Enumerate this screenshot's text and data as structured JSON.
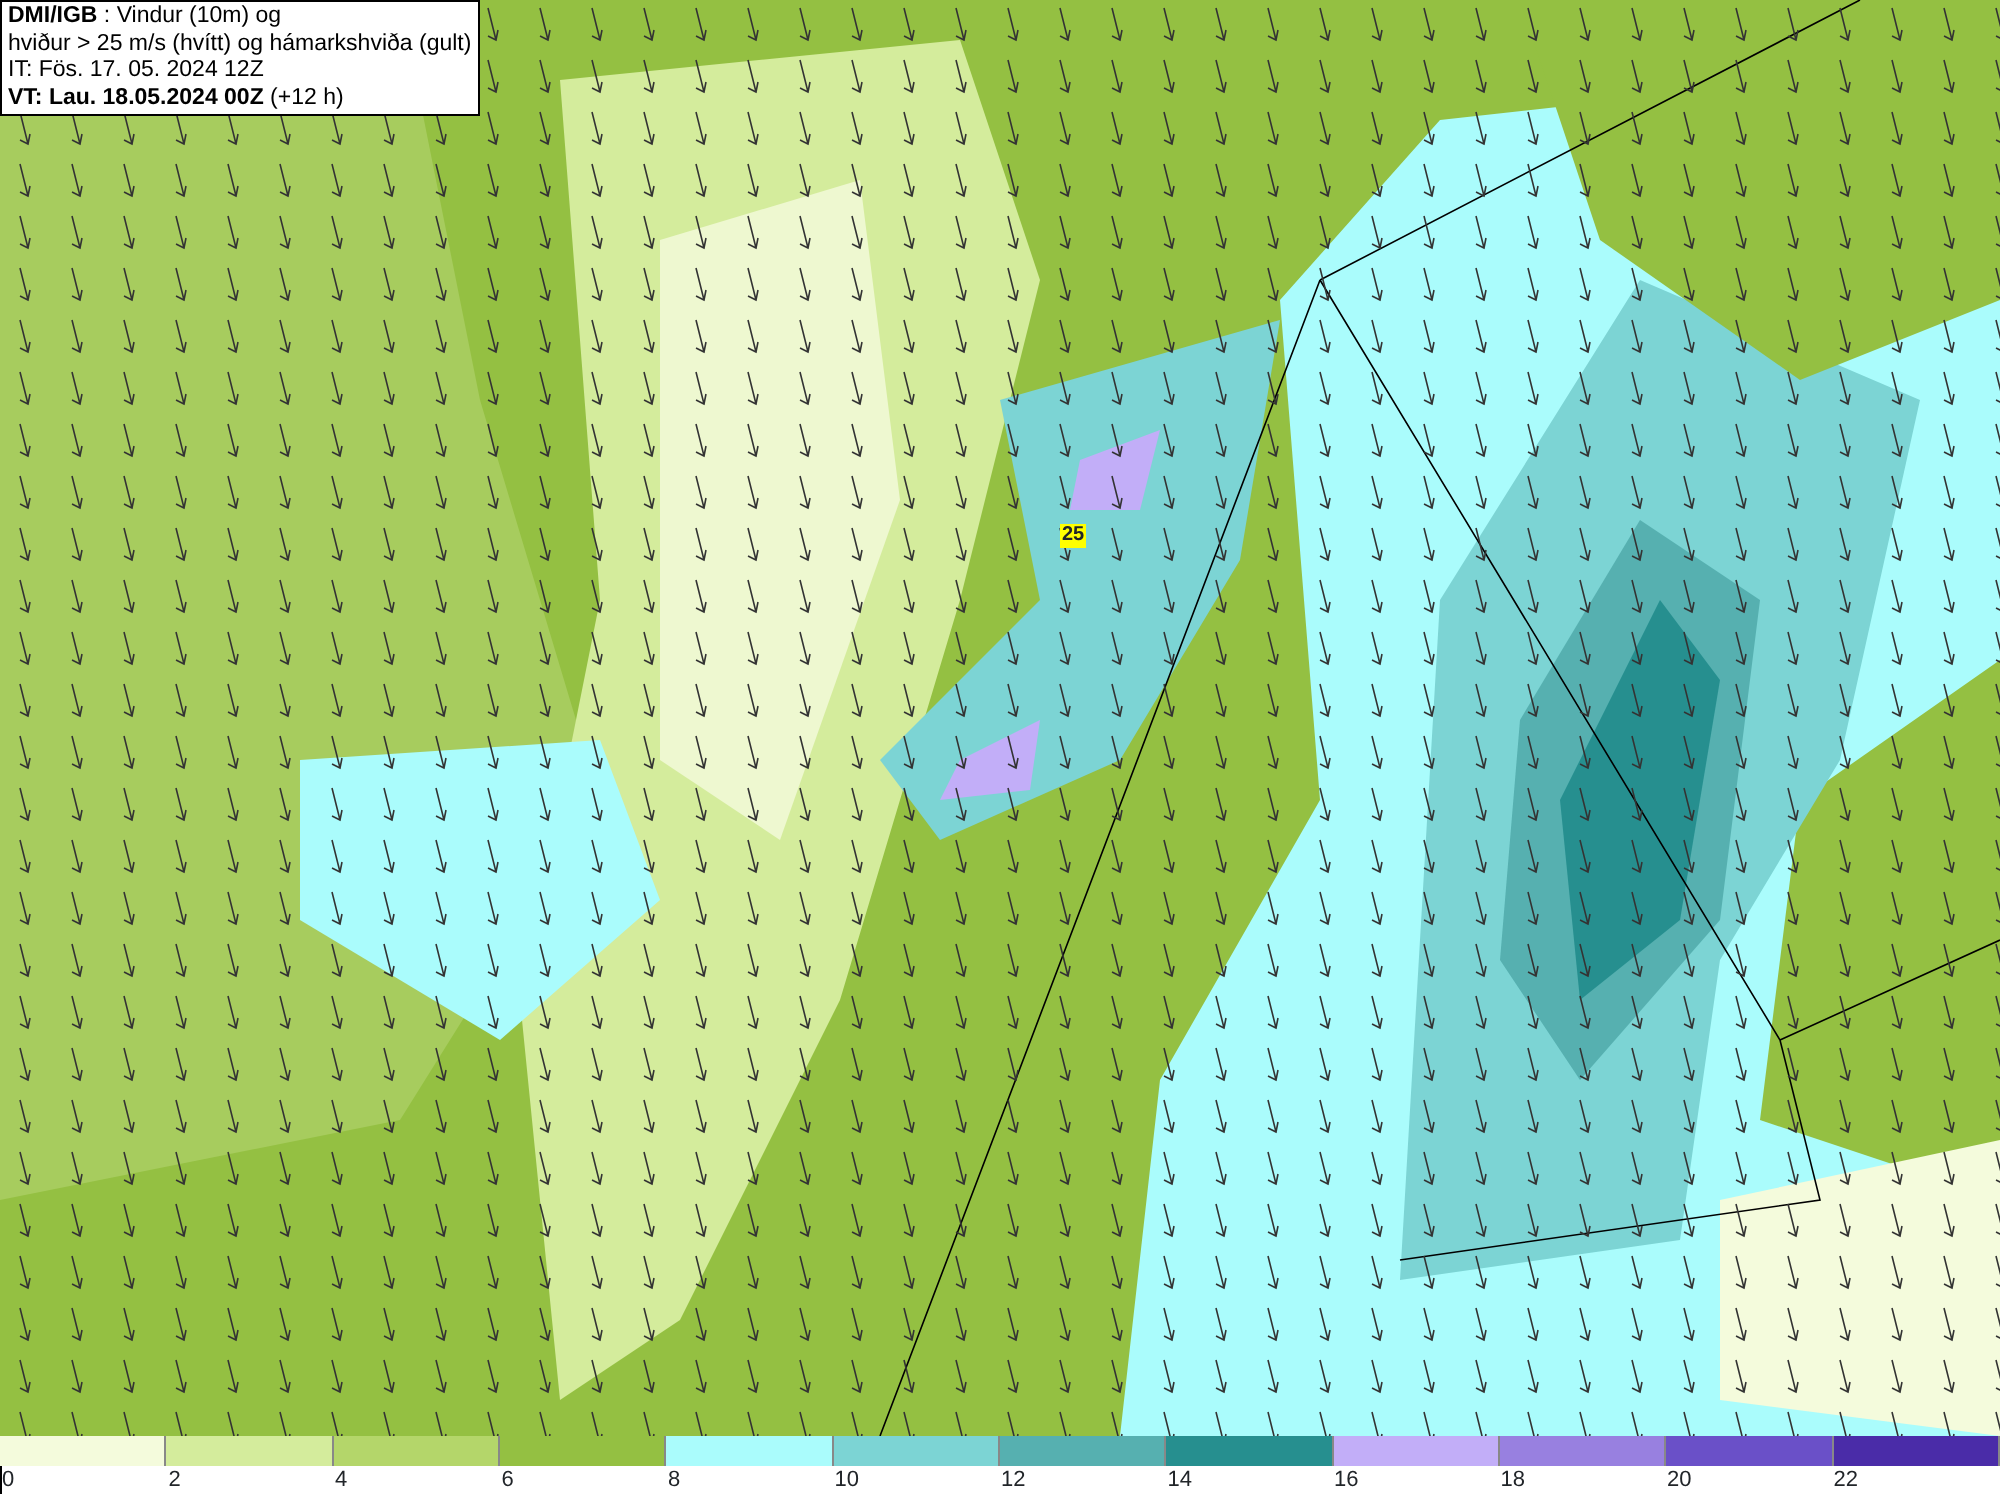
{
  "title_box": {
    "lines": [
      "**DMI/IGB** : Vindur (10m) og",
      "hviður > 25 m/s (hvítt) og hámarkshviða (gult)",
      "IT: Fös. 17. 05. 2024 12Z",
      "**VT: Lau. 18.05.2024 00Z** (+12 h)"
    ]
  },
  "map": {
    "max_gust_label": "25"
  },
  "legend": [
    {
      "label": "0",
      "color": "#f4fbdc"
    },
    {
      "label": "2",
      "color": "#d4ec9c"
    },
    {
      "label": "4",
      "color": "#b4d66a"
    },
    {
      "label": "6",
      "color": "#94c042"
    },
    {
      "label": "8",
      "color": "#aafcfc"
    },
    {
      "label": "10",
      "color": "#7cd4d4"
    },
    {
      "label": "12",
      "color": "#56b0b0"
    },
    {
      "label": "14",
      "color": "#268f8f"
    },
    {
      "label": "16",
      "color": "#c2aef8"
    },
    {
      "label": "18",
      "color": "#9880e0"
    },
    {
      "label": "20",
      "color": "#6a50c8"
    },
    {
      "label": "22",
      "color": "#4a2ca8"
    }
  ]
}
